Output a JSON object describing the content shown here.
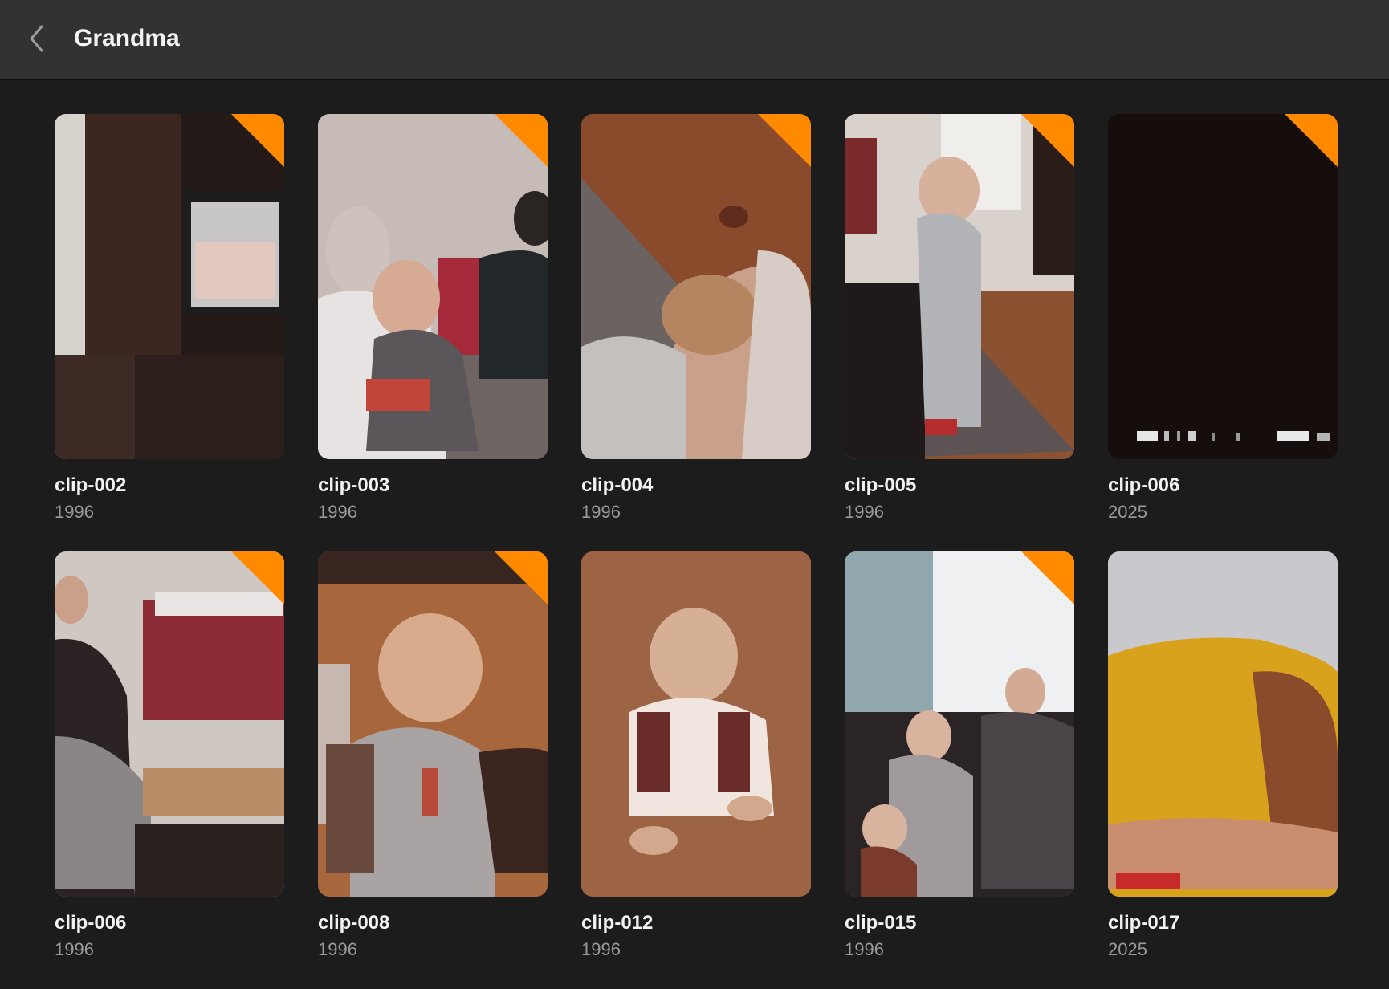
{
  "header": {
    "title": "Grandma",
    "back_icon": "chevron-left-icon"
  },
  "colors": {
    "background": "#1c1c1c",
    "titlebar": "#323232",
    "badge": "#ff8a00",
    "year_text": "#9a9a9a"
  },
  "clips": [
    {
      "name": "clip-002",
      "year": "1996",
      "badge": true
    },
    {
      "name": "clip-003",
      "year": "1996",
      "badge": true
    },
    {
      "name": "clip-004",
      "year": "1996",
      "badge": true
    },
    {
      "name": "clip-005",
      "year": "1996",
      "badge": true
    },
    {
      "name": "clip-006",
      "year": "2025",
      "badge": true
    },
    {
      "name": "clip-006",
      "year": "1996",
      "badge": true
    },
    {
      "name": "clip-008",
      "year": "1996",
      "badge": true
    },
    {
      "name": "clip-012",
      "year": "1996",
      "badge": false
    },
    {
      "name": "clip-015",
      "year": "1996",
      "badge": true
    },
    {
      "name": "clip-017",
      "year": "2025",
      "badge": false
    }
  ]
}
